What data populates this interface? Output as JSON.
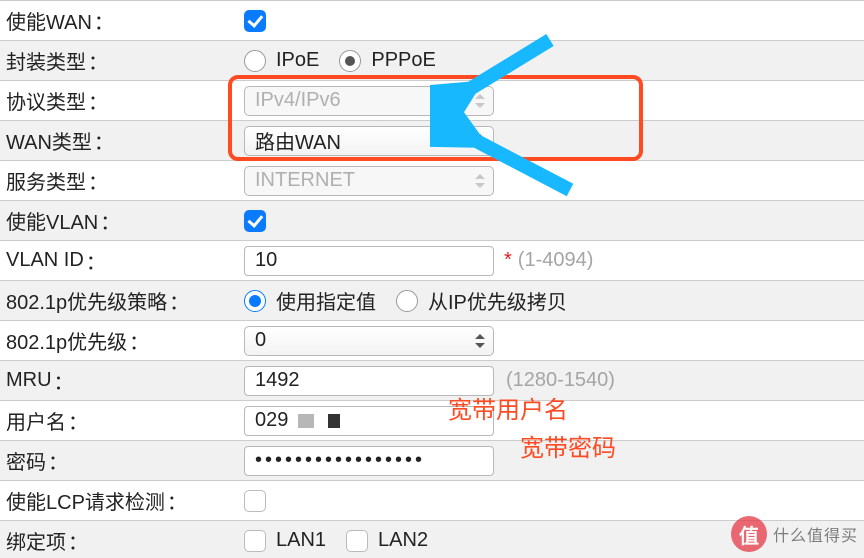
{
  "rows": {
    "enable_wan": {
      "label": "使能WAN",
      "checked": true
    },
    "encap": {
      "label": "封装类型",
      "opt1": "IPoE",
      "opt2": "PPPoE",
      "selected": "PPPoE"
    },
    "protocol": {
      "label": "协议类型",
      "value": "IPv4/IPv6"
    },
    "wan_type": {
      "label": "WAN类型",
      "value": "路由WAN"
    },
    "service": {
      "label": "服务类型",
      "value": "INTERNET"
    },
    "enable_vlan": {
      "label": "使能VLAN",
      "checked": true
    },
    "vlan_id": {
      "label": "VLAN ID",
      "value": "10",
      "hint": "(1-4094)",
      "star": "*"
    },
    "dot1p_policy": {
      "label": "802.1p优先级策略",
      "opt1": "使用指定值",
      "opt2": "从IP优先级拷贝",
      "selected": "使用指定值"
    },
    "dot1p_prio": {
      "label": "802.1p优先级",
      "value": "0"
    },
    "mru": {
      "label": "MRU",
      "value": "1492",
      "hint": "(1280-1540)"
    },
    "username": {
      "label": "用户名",
      "value": "029"
    },
    "password": {
      "label": "密码",
      "value": "•••••••••••••••••"
    },
    "lcp": {
      "label": "使能LCP请求检测",
      "checked": false
    },
    "binding": {
      "label": "绑定项",
      "opt1": "LAN1",
      "opt2": "LAN2"
    }
  },
  "annotations": {
    "username": "宽带用户名",
    "password": "宽带密码"
  },
  "watermark": {
    "badge": "值",
    "text": "什么值得买"
  },
  "colon": "："
}
